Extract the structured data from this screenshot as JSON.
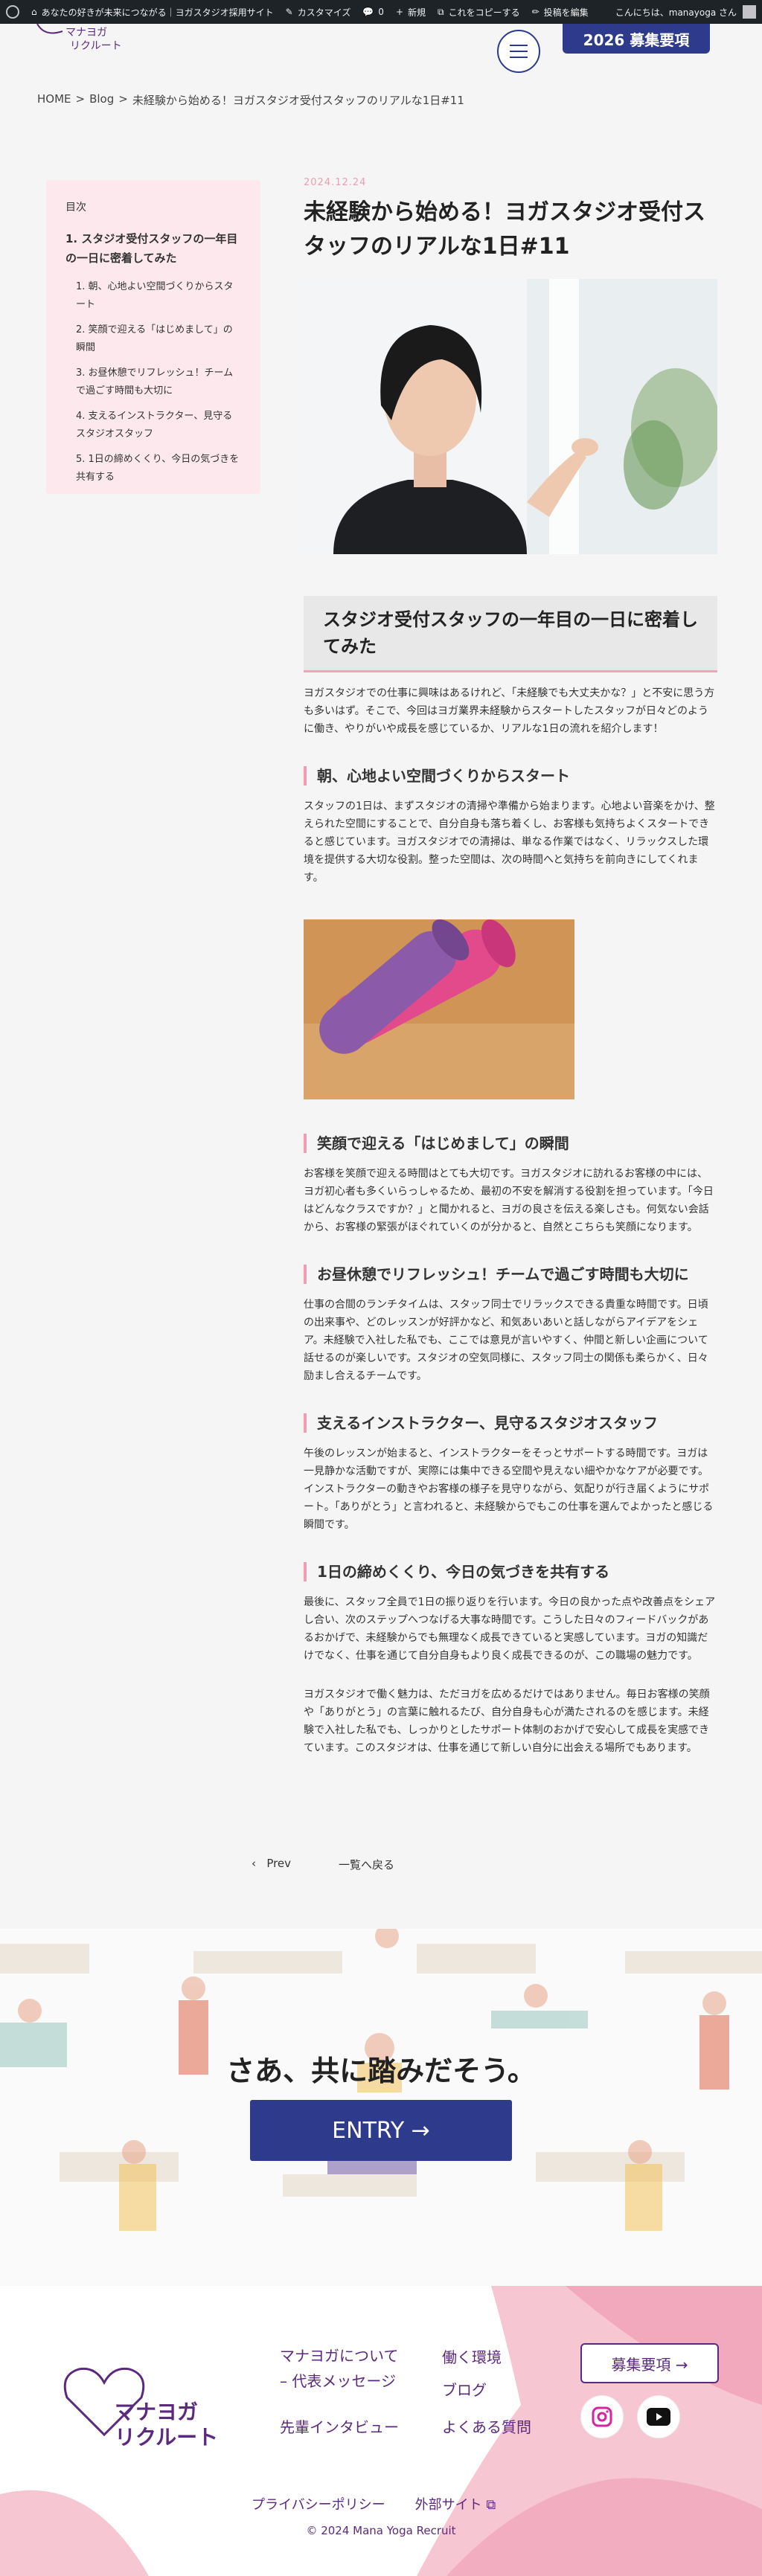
{
  "adminbar": {
    "site_name": "あなたの好きが未来につながる｜ヨガスタジオ採用サイト",
    "customize": "カスタマイズ",
    "comments": "0",
    "new": "新規",
    "copy": "これをコピーする",
    "edit": "投稿を編集",
    "greeting": "こんにちは、manayoga さん"
  },
  "header": {
    "logo_text": "マナヨガリクルート",
    "recruit_button": "2026 募集要項"
  },
  "breadcrumb": {
    "home": "HOME",
    "sep": ">",
    "blog": "Blog",
    "current": "未経験から始める！ヨガスタジオ受付スタッフのリアルな1日#11"
  },
  "toc": {
    "title": "目次",
    "main": "1. スタジオ受付スタッフの一年目の一日に密着してみた",
    "items": [
      "1. 朝、心地よい空間づくりからスタート",
      "2. 笑顔で迎える「はじめまして」の瞬間",
      "3. お昼休憩でリフレッシュ！チームで過ごす時間も大切に",
      "4. 支えるインストラクター、見守るスタジオスタッフ",
      "5. 1日の締めくくり、今日の気づきを共有する"
    ]
  },
  "article": {
    "date": "2024.12.24",
    "title": "未経験から始める！ヨガスタジオ受付スタッフのリアルな1日#11",
    "h2": "スタジオ受付スタッフの一年目の一日に密着してみた",
    "intro": "ヨガスタジオでの仕事に興味はあるけれど、「未経験でも大丈夫かな？」と不安に思う方も多いはず。そこで、今回はヨガ業界未経験からスタートしたスタッフが日々どのように働き、やりがいや成長を感じているか、リアルな1日の流れを紹介します！",
    "s1_title": "朝、心地よい空間づくりからスタート",
    "s1_text": "スタッフの1日は、まずスタジオの清掃や準備から始まります。心地よい音楽をかけ、整えられた空間にすることで、自分自身も落ち着くし、お客様も気持ちよくスタートできると感じています。ヨガスタジオでの清掃は、単なる作業ではなく、リラックスした環境を提供する大切な役割。整った空間は、次の時間へと気持ちを前向きにしてくれます。",
    "s2_title": "笑顔で迎える「はじめまして」の瞬間",
    "s2_text": "お客様を笑顔で迎える時間はとても大切です。ヨガスタジオに訪れるお客様の中には、ヨガ初心者も多くいらっしゃるため、最初の不安を解消する役割を担っています。「今日はどんなクラスですか？」と聞かれると、ヨガの良さを伝える楽しさも。何気ない会話から、お客様の緊張がほぐれていくのが分かると、自然とこちらも笑顔になります。",
    "s3_title": "お昼休憩でリフレッシュ！チームで過ごす時間も大切に",
    "s3_text": "仕事の合間のランチタイムは、スタッフ同士でリラックスできる貴重な時間です。日頃の出来事や、どのレッスンが好評かなど、和気あいあいと話しながらアイデアをシェア。未経験で入社した私でも、ここでは意見が言いやすく、仲間と新しい企画について話せるのが楽しいです。スタジオの空気同様に、スタッフ同士の関係も柔らかく、日々励まし合えるチームです。",
    "s4_title": "支えるインストラクター、見守るスタジオスタッフ",
    "s4_text": "午後のレッスンが始まると、インストラクターをそっとサポートする時間です。ヨガは一見静かな活動ですが、実際には集中できる空間や見えない細やかなケアが必要です。インストラクターの動きやお客様の様子を見守りながら、気配りが行き届くようにサポート。「ありがとう」と言われると、未経験からでもこの仕事を選んでよかったと感じる瞬間です。",
    "s5_title": "1日の締めくくり、今日の気づきを共有する",
    "s5_text": "最後に、スタッフ全員で1日の振り返りを行います。今日の良かった点や改善点をシェアし合い、次のステップへつなげる大事な時間です。こうした日々のフィードバックがあるおかげで、未経験からでも無理なく成長できていると実感しています。ヨガの知識だけでなく、仕事を通じて自分自身もより良く成長できるのが、この職場の魅力です。",
    "outro": "ヨガスタジオで働く魅力は、ただヨガを広めるだけではありません。毎日お客様の笑顔や「ありがとう」の言葉に触れるたび、自分自身も心が満たされるのを感じます。未経験で入社した私でも、しっかりとしたサポート体制のおかげで安心して成長を実感できています。このスタジオは、仕事を通じて新しい自分に出会える場所でもあります。"
  },
  "pager": {
    "prev": "Prev",
    "back": "一覧へ戻る"
  },
  "cta": {
    "title": "さあ、共に踏みだそう。",
    "entry": "ENTRY →"
  },
  "footer": {
    "logo_line1": "マナヨガ",
    "logo_line2": "リクルート",
    "about": "マナヨガについて",
    "message": "– 代表メッセージ",
    "interview": "先輩インタビュー",
    "environment": "働く環境",
    "blog": "ブログ",
    "faq": "よくある質問",
    "recruit": "募集要項 →",
    "privacy": "プライバシーポリシー",
    "external": "外部サイト",
    "copyright": "© 2024 Mana Yoga Recruit"
  },
  "colors": {
    "navy": "#2e3a8c",
    "purple": "#5c2a7d",
    "pink": "#f29cb3",
    "toc_bg": "#fde8ee"
  }
}
